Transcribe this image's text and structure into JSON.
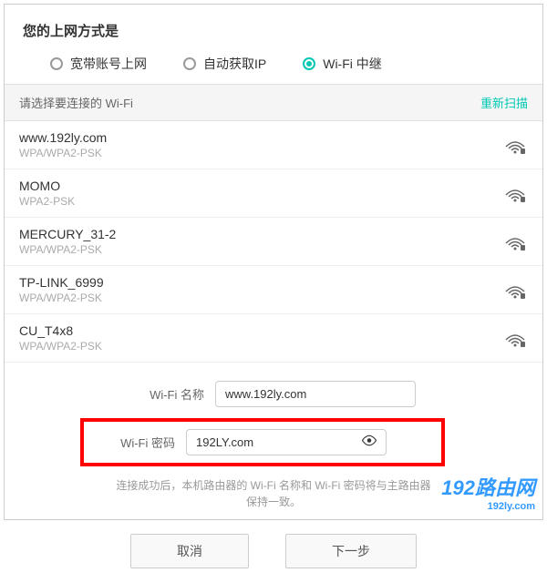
{
  "header": {
    "title": "您的上网方式是",
    "options": [
      {
        "label": "宽带账号上网",
        "selected": false
      },
      {
        "label": "自动获取IP",
        "selected": false
      },
      {
        "label": "Wi-Fi 中继",
        "selected": true
      }
    ]
  },
  "list_header": {
    "prompt": "请选择要连接的 Wi-Fi",
    "rescan": "重新扫描"
  },
  "wifi_networks": [
    {
      "name": "www.192ly.com",
      "security": "WPA/WPA2-PSK"
    },
    {
      "name": "MOMO",
      "security": "WPA2-PSK"
    },
    {
      "name": "MERCURY_31-2",
      "security": "WPA/WPA2-PSK"
    },
    {
      "name": "TP-LINK_6999",
      "security": "WPA/WPA2-PSK"
    },
    {
      "name": "CU_T4x8",
      "security": "WPA/WPA2-PSK"
    }
  ],
  "form": {
    "name_label": "Wi-Fi 名称",
    "name_value": "www.192ly.com",
    "password_label": "Wi-Fi 密码",
    "password_value": "192LY.com",
    "hint": "连接成功后，本机路由器的 Wi-Fi 名称和 Wi-Fi 密码将与主路由器保持一致。"
  },
  "buttons": {
    "cancel": "取消",
    "next": "下一步"
  },
  "watermark": {
    "main": "192路由网",
    "sub": "192ly.com"
  }
}
